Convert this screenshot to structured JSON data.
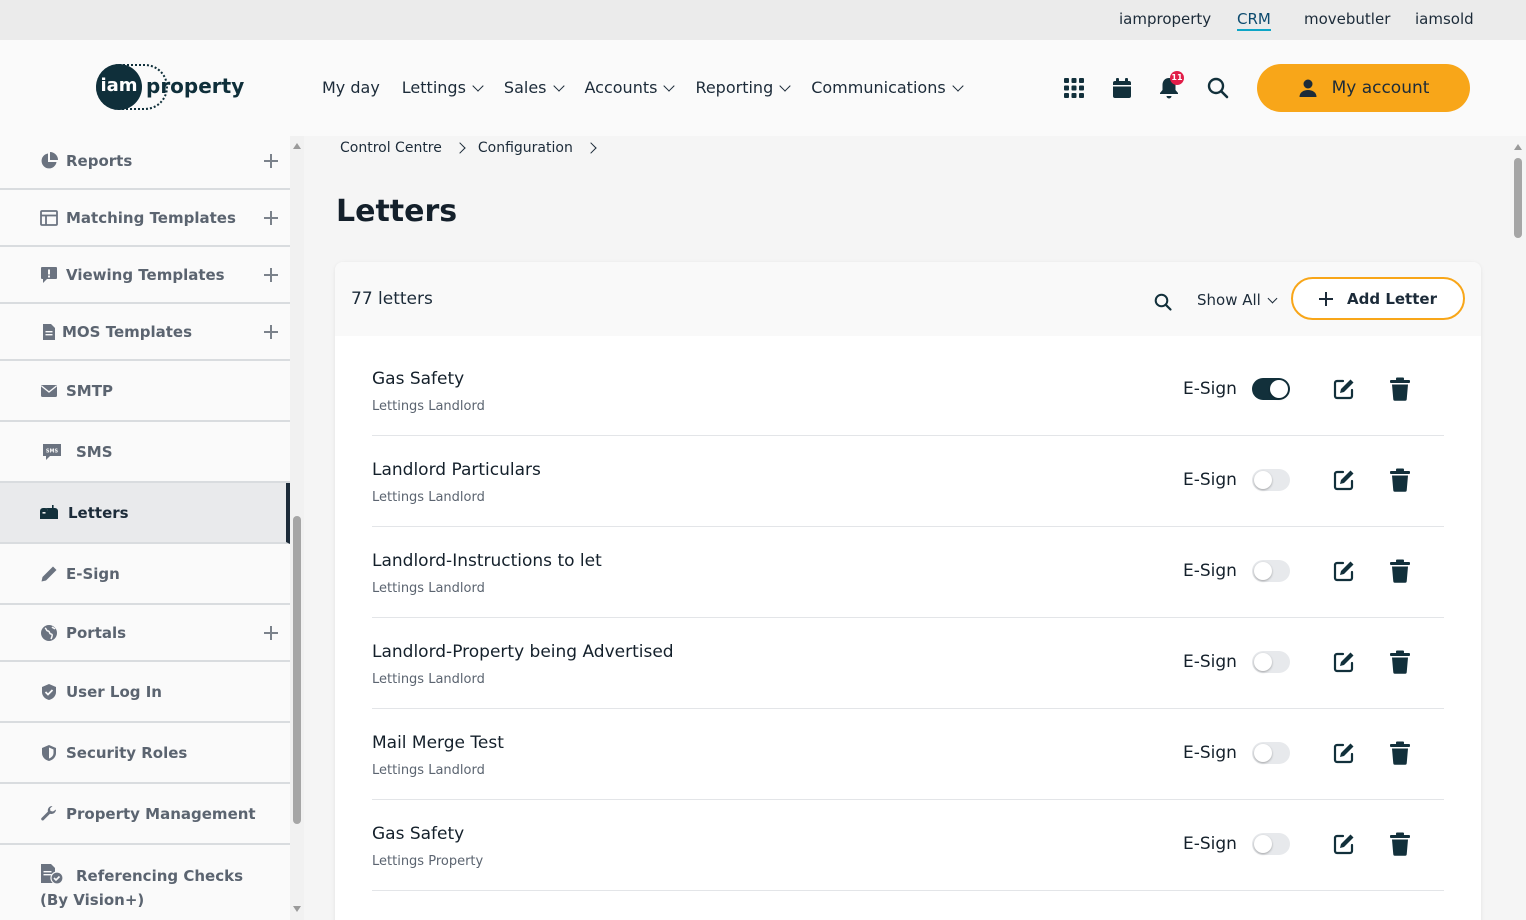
{
  "topbar": {
    "links": [
      "iamproperty",
      "CRM",
      "movebutler",
      "iamsold"
    ],
    "active": "CRM"
  },
  "header": {
    "logo_mark": "iam",
    "logo_text": "property",
    "nav": [
      "My day",
      "Lettings",
      "Sales",
      "Accounts",
      "Reporting",
      "Communications"
    ],
    "notification_count": "11",
    "account_label": "My account",
    "accent_color": "#f8a619"
  },
  "sidebar": {
    "items": [
      {
        "label": "Reports",
        "icon": "pie-chart-icon",
        "expandable": true
      },
      {
        "label": "Matching Templates",
        "icon": "table-icon",
        "expandable": true
      },
      {
        "label": "Viewing Templates",
        "icon": "comment-alert-icon",
        "expandable": true
      },
      {
        "label": "MOS Templates",
        "icon": "file-icon",
        "expandable": true
      },
      {
        "label": "SMTP",
        "icon": "envelope-icon",
        "expandable": false
      },
      {
        "label": "SMS",
        "icon": "sms-icon",
        "expandable": false
      },
      {
        "label": "Letters",
        "icon": "mailbox-icon",
        "expandable": false,
        "active": true
      },
      {
        "label": "E-Sign",
        "icon": "pencil-icon",
        "expandable": false
      },
      {
        "label": "Portals",
        "icon": "globe-icon",
        "expandable": true
      },
      {
        "label": "User Log In",
        "icon": "shield-check-icon",
        "expandable": false
      },
      {
        "label": "Security Roles",
        "icon": "shield-icon",
        "expandable": false
      },
      {
        "label": "Property Management",
        "icon": "wrench-icon",
        "expandable": false
      },
      {
        "label": "Referencing Checks",
        "label2": "(By Vision+)",
        "icon": "file-check-icon",
        "expandable": false
      }
    ]
  },
  "breadcrumb": [
    "Control Centre",
    "Configuration"
  ],
  "page_title": "Letters",
  "list": {
    "count_label": "77 letters",
    "filter_label": "Show All",
    "add_label": "Add Letter",
    "esign_label": "E-Sign",
    "rows": [
      {
        "title": "Gas Safety",
        "subtitle": "Lettings Landlord",
        "esign": true
      },
      {
        "title": "Landlord Particulars",
        "subtitle": "Lettings Landlord",
        "esign": false
      },
      {
        "title": "Landlord-Instructions to let",
        "subtitle": "Lettings Landlord",
        "esign": false
      },
      {
        "title": "Landlord-Property being Advertised",
        "subtitle": "Lettings Landlord",
        "esign": false
      },
      {
        "title": "Mail Merge Test",
        "subtitle": "Lettings Landlord",
        "esign": false
      },
      {
        "title": "Gas Safety",
        "subtitle": "Lettings Property",
        "esign": false
      }
    ]
  }
}
